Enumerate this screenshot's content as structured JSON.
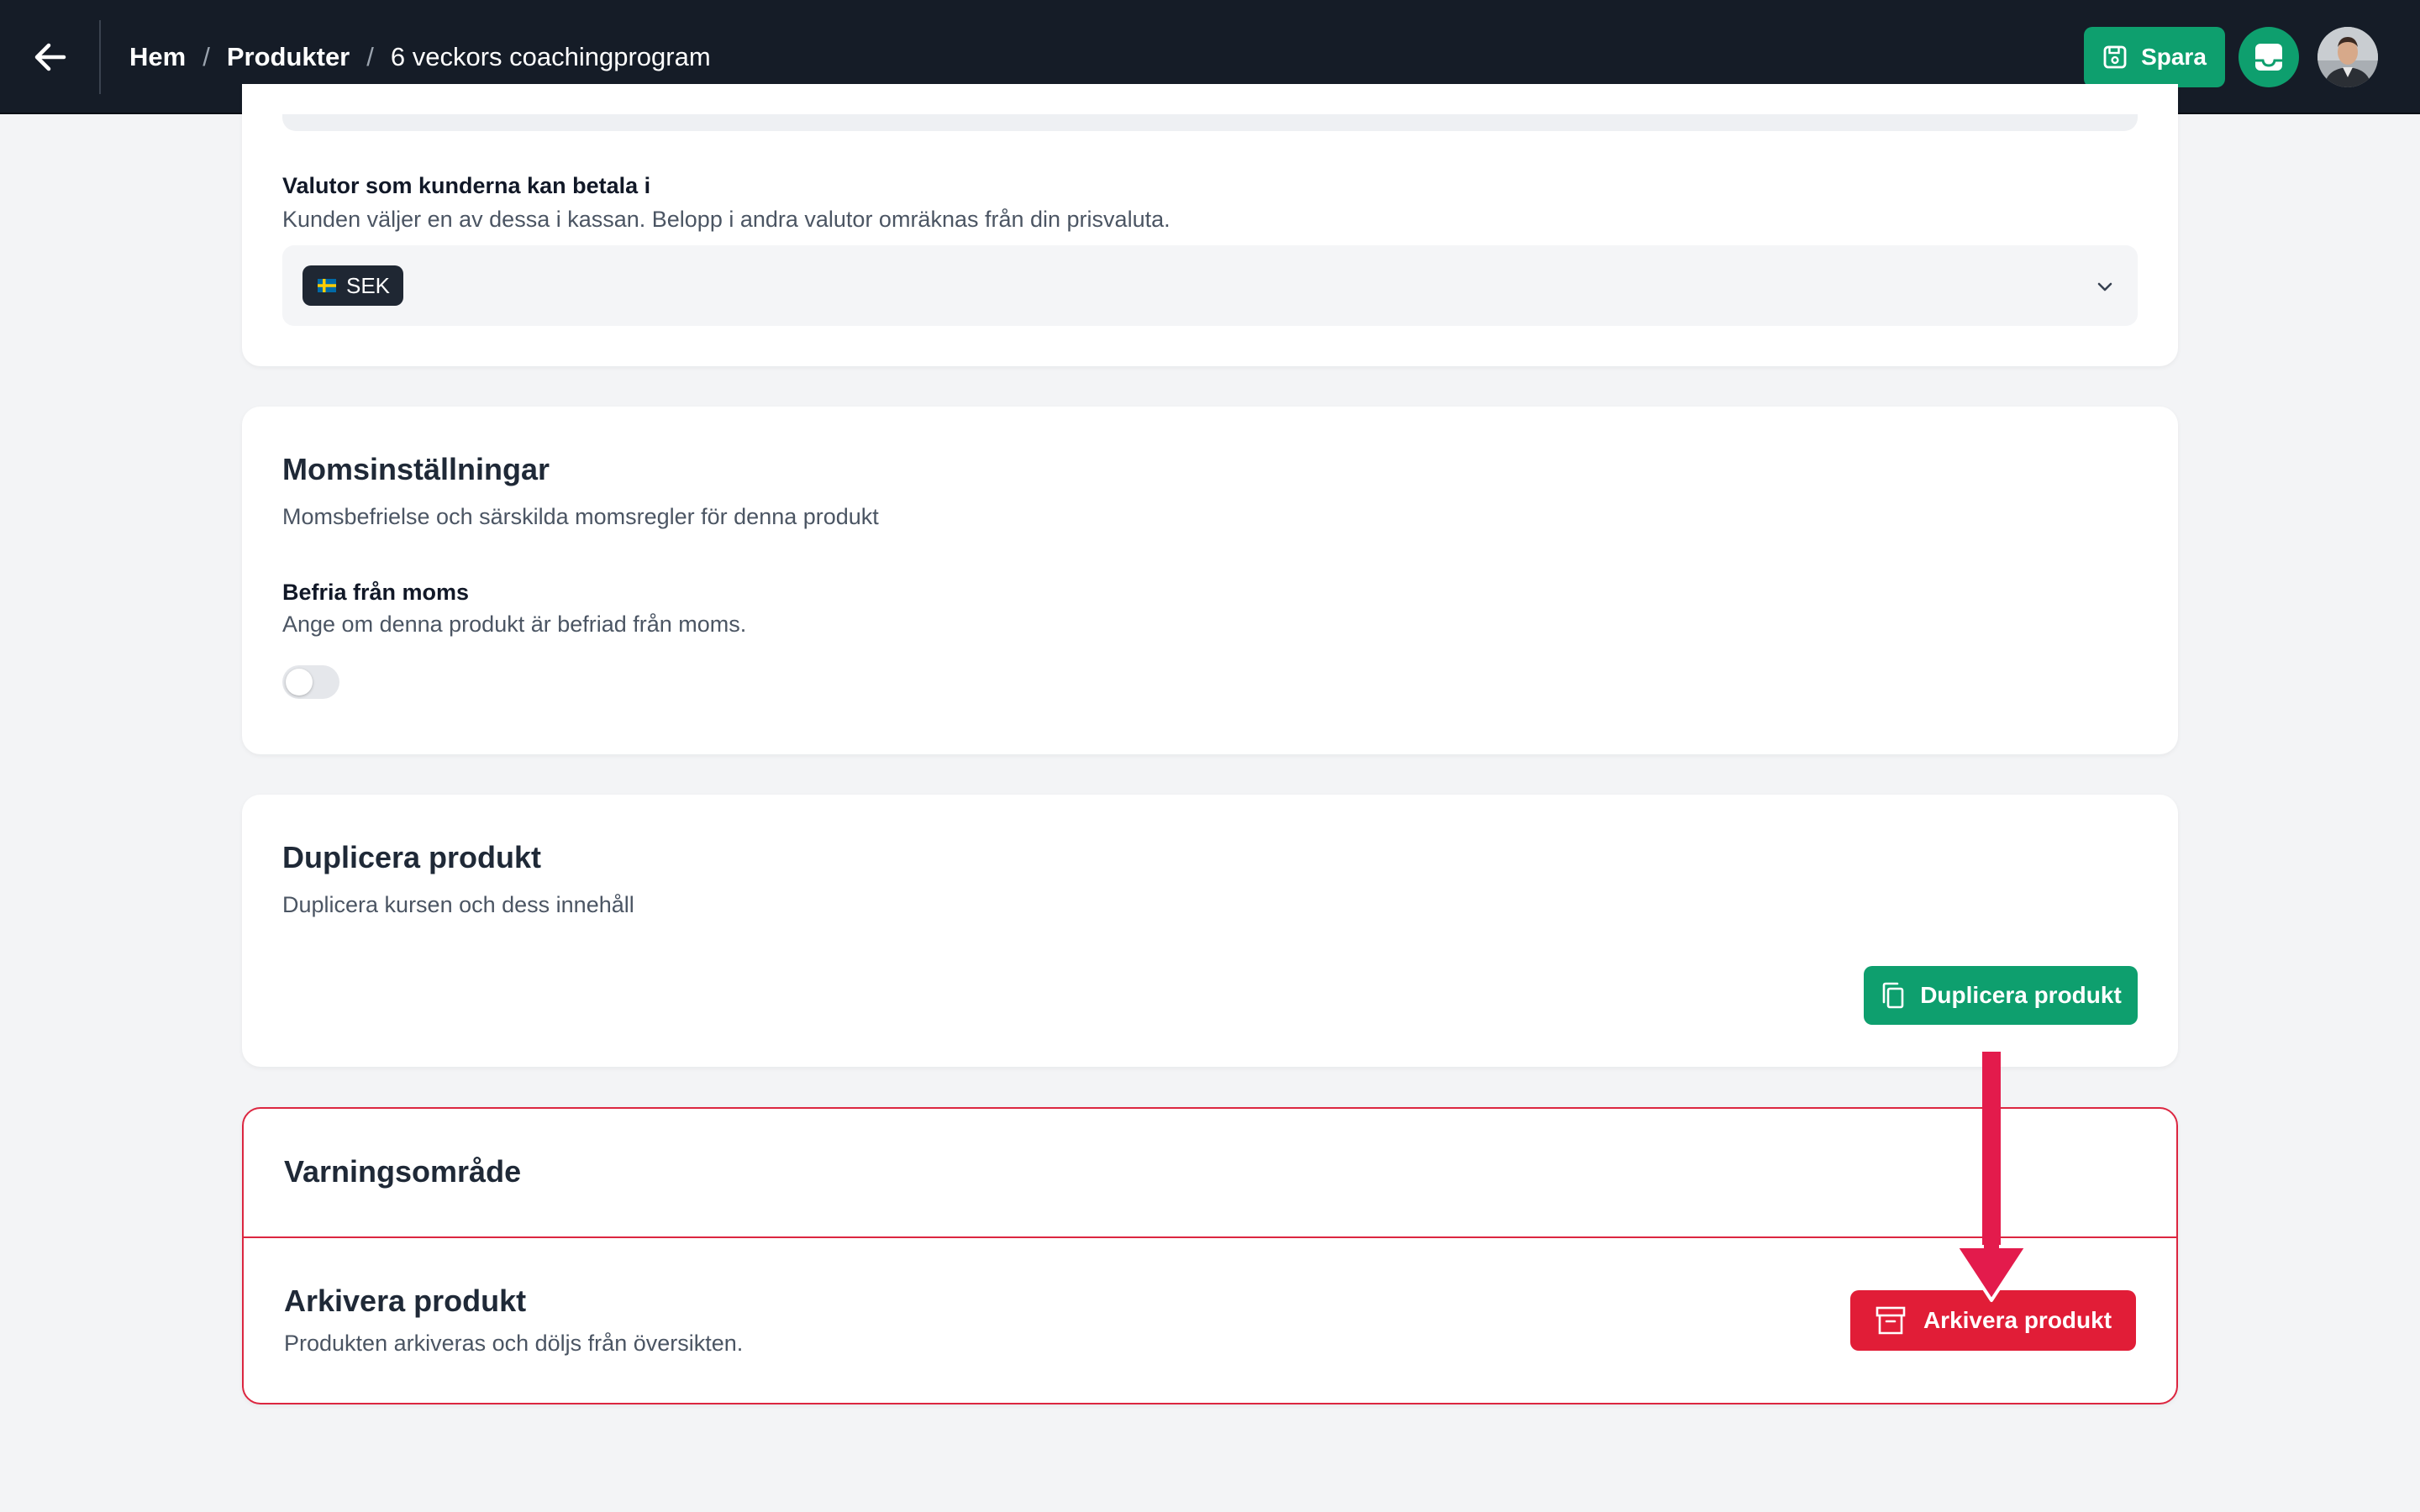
{
  "header": {
    "breadcrumb": {
      "home": "Hem",
      "separator": "/",
      "products": "Produkter",
      "current": "6 veckors coachingprogram"
    },
    "save_label": "Spara",
    "icons": {
      "back": "arrow-left-icon",
      "save": "floppy-disk-icon",
      "inbox": "inbox-icon"
    }
  },
  "currency": {
    "label": "Valutor som kunderna kan betala i",
    "help": "Kunden väljer en av dessa i kassan. Belopp i andra valutor omräknas från din prisvaluta.",
    "selected": [
      {
        "code": "SEK",
        "flag": "swedish-flag-icon"
      }
    ]
  },
  "vat": {
    "title": "Momsinställningar",
    "description": "Momsbefrielse och särskilda momsregler för denna produkt",
    "exempt_label": "Befria från moms",
    "exempt_help": "Ange om denna produkt är befriad från moms.",
    "exempt_enabled": false
  },
  "duplicate": {
    "title": "Duplicera produkt",
    "description": "Duplicera kursen och dess innehåll",
    "button_label": "Duplicera produkt"
  },
  "danger_zone": {
    "title": "Varningsområde",
    "archive_title": "Arkivera produkt",
    "archive_description": "Produkten arkiveras och döljs från översikten.",
    "archive_button_label": "Arkivera produkt"
  },
  "colors": {
    "header_bg": "#151c27",
    "primary_green": "#0e9f6e",
    "danger_red": "#e11d37",
    "annotation_arrow": "#e31b4c"
  }
}
